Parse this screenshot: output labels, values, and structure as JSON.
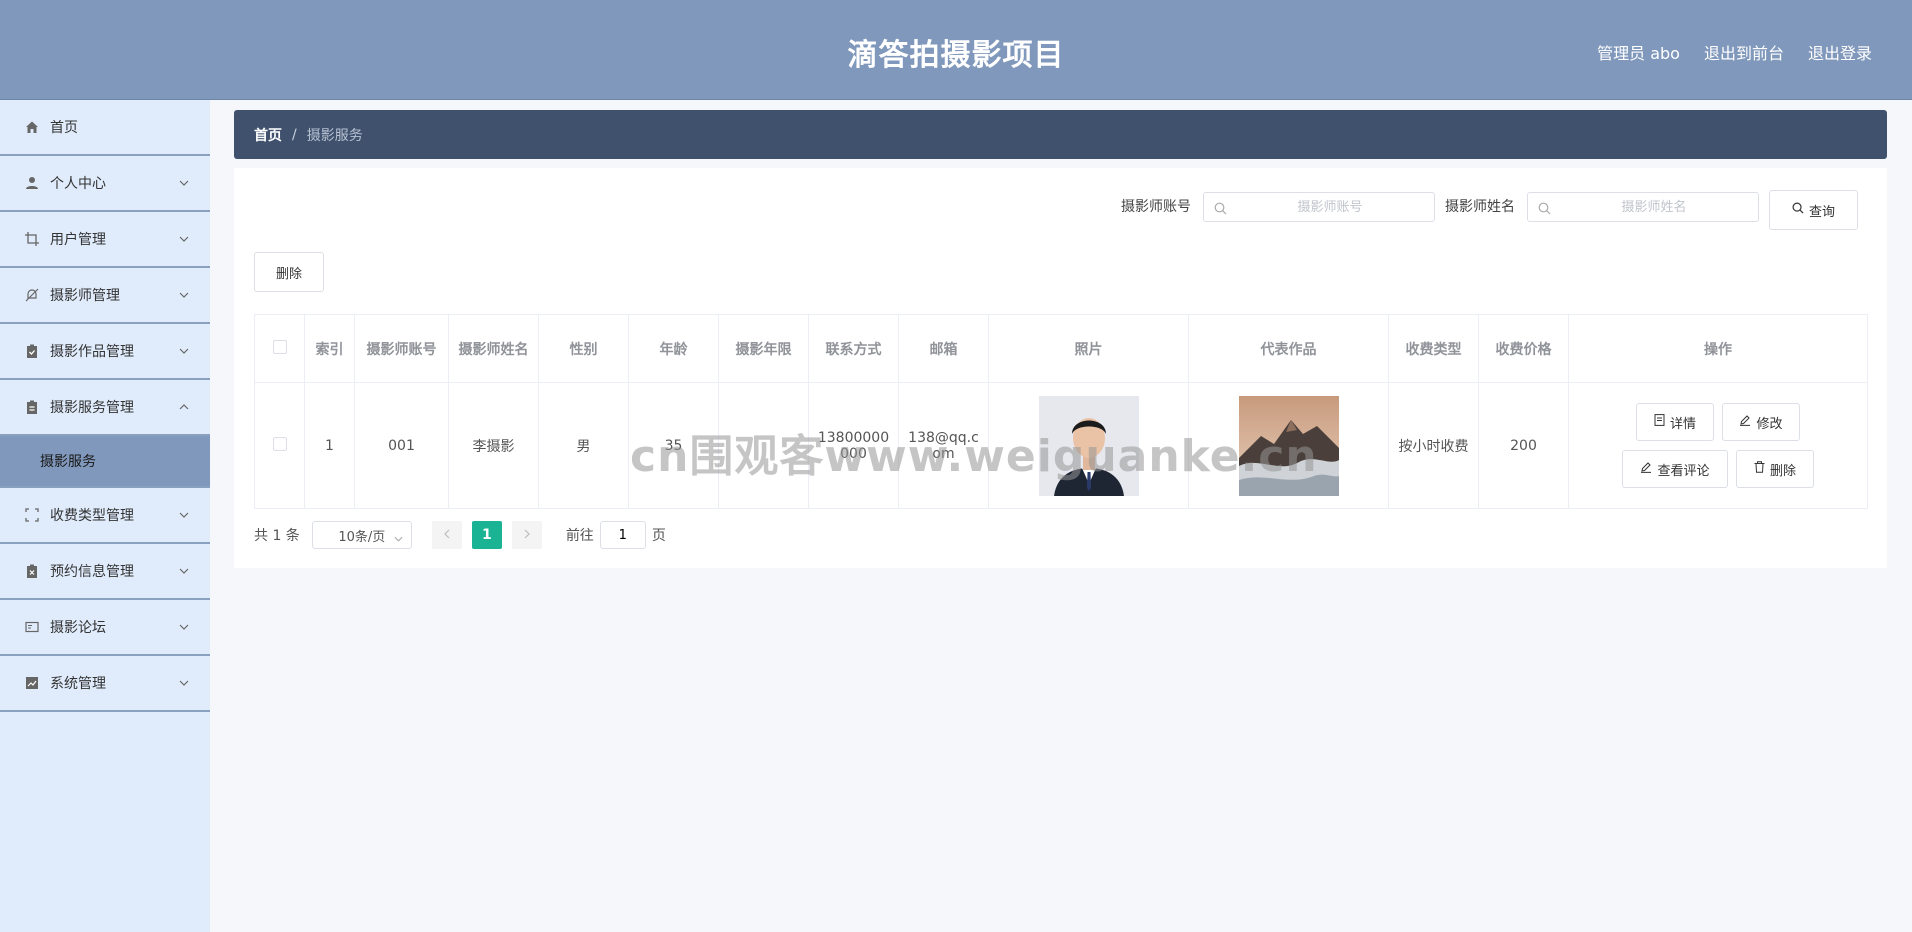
{
  "header": {
    "title": "滴答拍摄影项目",
    "admin": "管理员 abo",
    "exit_front": "退出到前台",
    "logout": "退出登录"
  },
  "sidebar": {
    "items": [
      {
        "label": "首页",
        "icon": "home-icon"
      },
      {
        "label": "个人中心",
        "icon": "user-icon"
      },
      {
        "label": "用户管理",
        "icon": "crop-icon"
      },
      {
        "label": "摄影师管理",
        "icon": "bell-off-icon"
      },
      {
        "label": "摄影作品管理",
        "icon": "clipboard-check-icon"
      },
      {
        "label": "摄影服务管理",
        "icon": "clipboard-icon"
      },
      {
        "label": "收费类型管理",
        "icon": "fullscreen-icon"
      },
      {
        "label": "预约信息管理",
        "icon": "clipboard-x-icon"
      },
      {
        "label": "摄影论坛",
        "icon": "postcard-icon"
      },
      {
        "label": "系统管理",
        "icon": "chart-icon"
      }
    ],
    "sub_active": "摄影服务"
  },
  "breadcrumb": {
    "home": "首页",
    "sep": "/",
    "current": "摄影服务"
  },
  "search": {
    "account_label": "摄影师账号",
    "account_placeholder": "摄影师账号",
    "name_label": "摄影师姓名",
    "name_placeholder": "摄影师姓名",
    "query_btn": "查询"
  },
  "toolbar": {
    "delete_btn": "删除"
  },
  "table": {
    "headers": [
      "索引",
      "摄影师账号",
      "摄影师姓名",
      "性别",
      "年龄",
      "摄影年限",
      "联系方式",
      "邮箱",
      "照片",
      "代表作品",
      "收费类型",
      "收费价格",
      "操作"
    ],
    "rows": [
      {
        "index": "1",
        "account": "001",
        "name": "李摄影",
        "gender": "男",
        "age": "35",
        "years": "",
        "phone": "13800000000",
        "email": "138@qq.com",
        "fee_type": "按小时收费",
        "price": "200"
      }
    ],
    "actions": {
      "detail": "详情",
      "edit": "修改",
      "comments": "查看评论",
      "delete": "删除"
    }
  },
  "pager": {
    "total": "共 1 条",
    "page_size": "10条/页",
    "current": "1",
    "goto": "前往",
    "goto_value": "1",
    "page_unit": "页"
  },
  "watermark": "cn围观客www.weiguanke.cn",
  "colors": {
    "header": "#8098bb",
    "sidebar": "#e0ecfc",
    "breadcrumb": "#3f516d",
    "active_page": "#1ab394"
  }
}
